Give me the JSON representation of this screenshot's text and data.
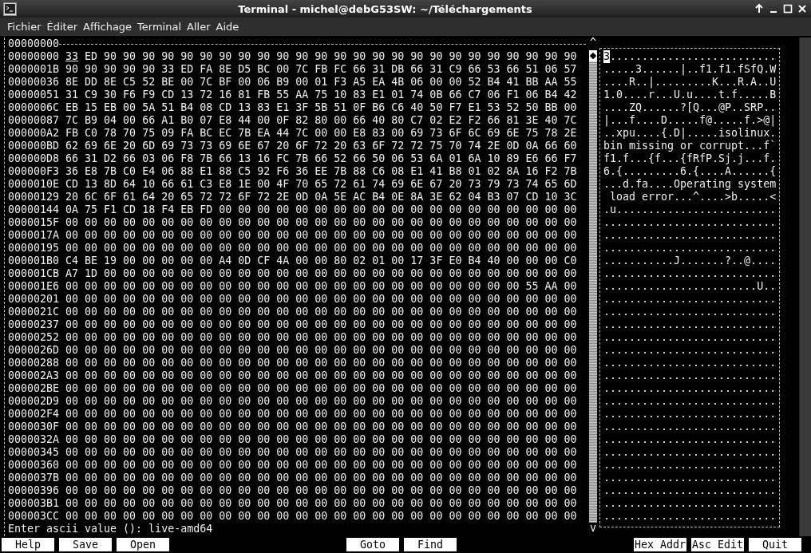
{
  "window": {
    "title": "Terminal - michel@debG53SW: ~/Téléchargements"
  },
  "menu": [
    "Fichier",
    "Éditer",
    "Affichage",
    "Terminal",
    "Aller",
    "Aide"
  ],
  "editor": {
    "offset_label": "00000000",
    "scroll_up": "^",
    "scroll_down": "v",
    "rows": [
      {
        "address": "00000000",
        "hex": "33 ED 90 90 90 90 90 90 90 90 90 90 90 90 90 90 90 90 90 90 90 90 90 90 90 90 90",
        "ascii": "3..........................",
        "cursor": true
      },
      {
        "address": "0000001B",
        "hex": "90 90 90 90 90 33 ED FA 8E D5 BC 00 7C FB FC 66 31 DB 66 31 C9 66 53 66 51 06 57",
        "ascii": ".....3......|..f1.f1.fSfQ.W",
        "cursor": false
      },
      {
        "address": "00000036",
        "hex": "8E DD 8E C5 52 BE 00 7C BF 00 06 B9 00 01 F3 A5 EA 4B 06 00 00 52 B4 41 BB AA 55",
        "ascii": "....R..|.........K...R.A..U",
        "cursor": false
      },
      {
        "address": "00000051",
        "hex": "31 C9 30 F6 F9 CD 13 72 16 81 FB 55 AA 75 10 83 E1 01 74 0B 66 C7 06 F1 06 B4 42",
        "ascii": "1.0....r...U.u....t.f.....B",
        "cursor": false
      },
      {
        "address": "0000006C",
        "hex": "EB 15 EB 00 5A 51 B4 08 CD 13 83 E1 3F 5B 51 0F B6 C6 40 50 F7 E1 53 52 50 BB 00",
        "ascii": "....ZQ......?[Q...@P..SRP..",
        "cursor": false
      },
      {
        "address": "00000087",
        "hex": "7C B9 04 00 66 A1 B0 07 E8 44 00 0F 82 80 00 66 40 80 C7 02 E2 F2 66 81 3E 40 7C",
        "ascii": "|...f....D.....f@.....f.>@|",
        "cursor": false
      },
      {
        "address": "000000A2",
        "hex": "FB C0 78 70 75 09 FA BC EC 7B EA 44 7C 00 00 E8 83 00 69 73 6F 6C 69 6E 75 78 2E",
        "ascii": "..xpu....{.D|.....isolinux.",
        "cursor": false
      },
      {
        "address": "000000BD",
        "hex": "62 69 6E 20 6D 69 73 73 69 6E 67 20 6F 72 20 63 6F 72 72 75 70 74 2E 0D 0A 66 60",
        "ascii": "bin missing or corrupt...f`",
        "cursor": false
      },
      {
        "address": "000000D8",
        "hex": "66 31 D2 66 03 06 F8 7B 66 13 16 FC 7B 66 52 66 50 06 53 6A 01 6A 10 89 E6 66 F7",
        "ascii": "f1.f...{f...{fRfP.Sj.j...f.",
        "cursor": false
      },
      {
        "address": "000000F3",
        "hex": "36 E8 7B C0 E4 06 88 E1 88 C5 92 F6 36 EE 7B 88 C6 08 E1 41 B8 01 02 8A 16 F2 7B",
        "ascii": "6.{.........6.{....A......{",
        "cursor": false
      },
      {
        "address": "0000010E",
        "hex": "CD 13 8D 64 10 66 61 C3 E8 1E 00 4F 70 65 72 61 74 69 6E 67 20 73 79 73 74 65 6D",
        "ascii": "...d.fa....Operating system",
        "cursor": false
      },
      {
        "address": "00000129",
        "hex": "20 6C 6F 61 64 20 65 72 72 6F 72 2E 0D 0A 5E AC B4 0E 8A 3E 62 04 B3 07 CD 10 3C",
        "ascii": " load error...^....>b.....<",
        "cursor": false
      },
      {
        "address": "00000144",
        "hex": "0A 75 F1 CD 18 F4 EB FD 00 00 00 00 00 00 00 00 00 00 00 00 00 00 00 00 00 00 00",
        "ascii": ".u.........................",
        "cursor": false
      },
      {
        "address": "0000015F",
        "hex": "00 00 00 00 00 00 00 00 00 00 00 00 00 00 00 00 00 00 00 00 00 00 00 00 00 00 00",
        "ascii": "...........................",
        "cursor": false
      },
      {
        "address": "0000017A",
        "hex": "00 00 00 00 00 00 00 00 00 00 00 00 00 00 00 00 00 00 00 00 00 00 00 00 00 00 00",
        "ascii": "...........................",
        "cursor": false
      },
      {
        "address": "00000195",
        "hex": "00 00 00 00 00 00 00 00 00 00 00 00 00 00 00 00 00 00 00 00 00 00 00 00 00 00 00",
        "ascii": "...........................",
        "cursor": false
      },
      {
        "address": "000001B0",
        "hex": "C4 BE 19 00 00 00 00 00 A4 0D CF 4A 00 00 80 02 01 00 17 3F E0 B4 40 00 00 00 C0",
        "ascii": "...........J.......?..@....",
        "cursor": false
      },
      {
        "address": "000001CB",
        "hex": "A7 1D 00 00 00 00 00 00 00 00 00 00 00 00 00 00 00 00 00 00 00 00 00 00 00 00 00",
        "ascii": "...........................",
        "cursor": false
      },
      {
        "address": "000001E6",
        "hex": "00 00 00 00 00 00 00 00 00 00 00 00 00 00 00 00 00 00 00 00 00 00 00 00 55 AA 00",
        "ascii": "........................U..",
        "cursor": false
      },
      {
        "address": "00000201",
        "hex": "00 00 00 00 00 00 00 00 00 00 00 00 00 00 00 00 00 00 00 00 00 00 00 00 00 00 00",
        "ascii": "...........................",
        "cursor": false
      },
      {
        "address": "0000021C",
        "hex": "00 00 00 00 00 00 00 00 00 00 00 00 00 00 00 00 00 00 00 00 00 00 00 00 00 00 00",
        "ascii": "...........................",
        "cursor": false
      },
      {
        "address": "00000237",
        "hex": "00 00 00 00 00 00 00 00 00 00 00 00 00 00 00 00 00 00 00 00 00 00 00 00 00 00 00",
        "ascii": "...........................",
        "cursor": false
      },
      {
        "address": "00000252",
        "hex": "00 00 00 00 00 00 00 00 00 00 00 00 00 00 00 00 00 00 00 00 00 00 00 00 00 00 00",
        "ascii": "...........................",
        "cursor": false
      },
      {
        "address": "0000026D",
        "hex": "00 00 00 00 00 00 00 00 00 00 00 00 00 00 00 00 00 00 00 00 00 00 00 00 00 00 00",
        "ascii": "...........................",
        "cursor": false
      },
      {
        "address": "00000288",
        "hex": "00 00 00 00 00 00 00 00 00 00 00 00 00 00 00 00 00 00 00 00 00 00 00 00 00 00 00",
        "ascii": "...........................",
        "cursor": false
      },
      {
        "address": "000002A3",
        "hex": "00 00 00 00 00 00 00 00 00 00 00 00 00 00 00 00 00 00 00 00 00 00 00 00 00 00 00",
        "ascii": "...........................",
        "cursor": false
      },
      {
        "address": "000002BE",
        "hex": "00 00 00 00 00 00 00 00 00 00 00 00 00 00 00 00 00 00 00 00 00 00 00 00 00 00 00",
        "ascii": "...........................",
        "cursor": false
      },
      {
        "address": "000002D9",
        "hex": "00 00 00 00 00 00 00 00 00 00 00 00 00 00 00 00 00 00 00 00 00 00 00 00 00 00 00",
        "ascii": "...........................",
        "cursor": false
      },
      {
        "address": "000002F4",
        "hex": "00 00 00 00 00 00 00 00 00 00 00 00 00 00 00 00 00 00 00 00 00 00 00 00 00 00 00",
        "ascii": "...........................",
        "cursor": false
      },
      {
        "address": "0000030F",
        "hex": "00 00 00 00 00 00 00 00 00 00 00 00 00 00 00 00 00 00 00 00 00 00 00 00 00 00 00",
        "ascii": "...........................",
        "cursor": false
      },
      {
        "address": "0000032A",
        "hex": "00 00 00 00 00 00 00 00 00 00 00 00 00 00 00 00 00 00 00 00 00 00 00 00 00 00 00",
        "ascii": "...........................",
        "cursor": false
      },
      {
        "address": "00000345",
        "hex": "00 00 00 00 00 00 00 00 00 00 00 00 00 00 00 00 00 00 00 00 00 00 00 00 00 00 00",
        "ascii": "...........................",
        "cursor": false
      },
      {
        "address": "00000360",
        "hex": "00 00 00 00 00 00 00 00 00 00 00 00 00 00 00 00 00 00 00 00 00 00 00 00 00 00 00",
        "ascii": "...........................",
        "cursor": false
      },
      {
        "address": "0000037B",
        "hex": "00 00 00 00 00 00 00 00 00 00 00 00 00 00 00 00 00 00 00 00 00 00 00 00 00 00 00",
        "ascii": "...........................",
        "cursor": false
      },
      {
        "address": "00000396",
        "hex": "00 00 00 00 00 00 00 00 00 00 00 00 00 00 00 00 00 00 00 00 00 00 00 00 00 00 00",
        "ascii": "...........................",
        "cursor": false
      },
      {
        "address": "000003B1",
        "hex": "00 00 00 00 00 00 00 00 00 00 00 00 00 00 00 00 00 00 00 00 00 00 00 00 00 00 00",
        "ascii": "...........................",
        "cursor": false
      },
      {
        "address": "000003CC",
        "hex": "00 00 00 00 00 00 00 00 00 00 00 00 00 00 00 00 00 00 00 00 00 00 00 00 00 00 00",
        "ascii": "...........................",
        "cursor": false
      }
    ]
  },
  "prompt": "Enter ascii value (): live-amd64",
  "function_keys": [
    {
      "label": "Help",
      "kind": "left"
    },
    {
      "label": "Save",
      "kind": "left"
    },
    {
      "label": "Open",
      "kind": "left"
    },
    {
      "label": "Goto",
      "kind": "middle"
    },
    {
      "label": "Find",
      "kind": "middle"
    },
    {
      "label": "Hex Addr",
      "kind": "right"
    },
    {
      "label": "Asc Edit",
      "kind": "right"
    },
    {
      "label": "Quit",
      "kind": "right"
    }
  ]
}
